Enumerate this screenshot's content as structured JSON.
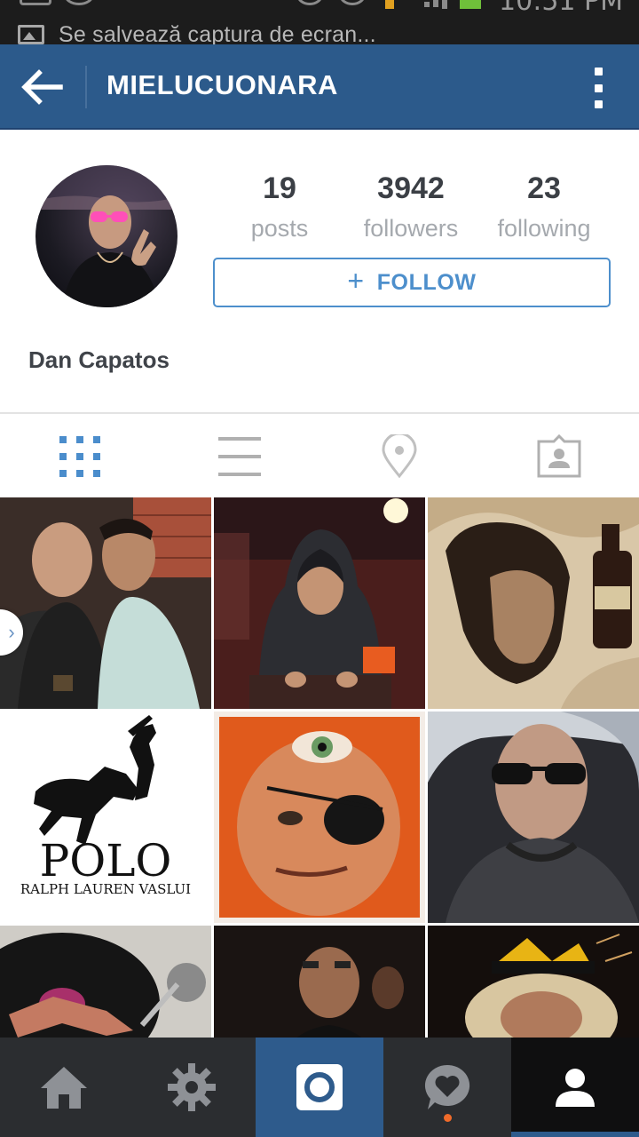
{
  "status_bar": {
    "notification_text": "Se salvează captura de ecran...",
    "time": "10:51 PM"
  },
  "app_bar": {
    "username": "MIELUCUONARA"
  },
  "profile": {
    "stats": [
      {
        "value": "19",
        "label": "posts"
      },
      {
        "value": "3942",
        "label": "followers"
      },
      {
        "value": "23",
        "label": "following"
      }
    ],
    "follow_button": {
      "icon": "+",
      "label": "FOLLOW"
    },
    "full_name": "Dan Capatos"
  },
  "tabs": [
    {
      "name": "grid",
      "icon": "grid-icon",
      "active": true
    },
    {
      "name": "list",
      "icon": "list-icon",
      "active": false
    },
    {
      "name": "map",
      "icon": "location-pin-icon",
      "active": false
    },
    {
      "name": "tagged",
      "icon": "tagged-photos-icon",
      "active": false
    }
  ],
  "photos": [
    {
      "id": "photo-1"
    },
    {
      "id": "photo-2"
    },
    {
      "id": "photo-3"
    },
    {
      "id": "photo-4",
      "logo_text": "POLO",
      "logo_subtext": "RALPH LAUREN VASLUI"
    },
    {
      "id": "photo-5"
    },
    {
      "id": "photo-6"
    },
    {
      "id": "photo-7"
    },
    {
      "id": "photo-8"
    },
    {
      "id": "photo-9"
    }
  ],
  "bottom_nav": [
    {
      "name": "home",
      "icon": "home-icon"
    },
    {
      "name": "explore",
      "icon": "explore-icon"
    },
    {
      "name": "camera",
      "icon": "camera-icon"
    },
    {
      "name": "activity",
      "icon": "activity-icon"
    },
    {
      "name": "profile",
      "icon": "profile-icon",
      "active": true
    }
  ],
  "colors": {
    "app_bar": "#2c5a8b",
    "accent": "#4d8fcc",
    "notification_dot": "#f06b2a"
  }
}
